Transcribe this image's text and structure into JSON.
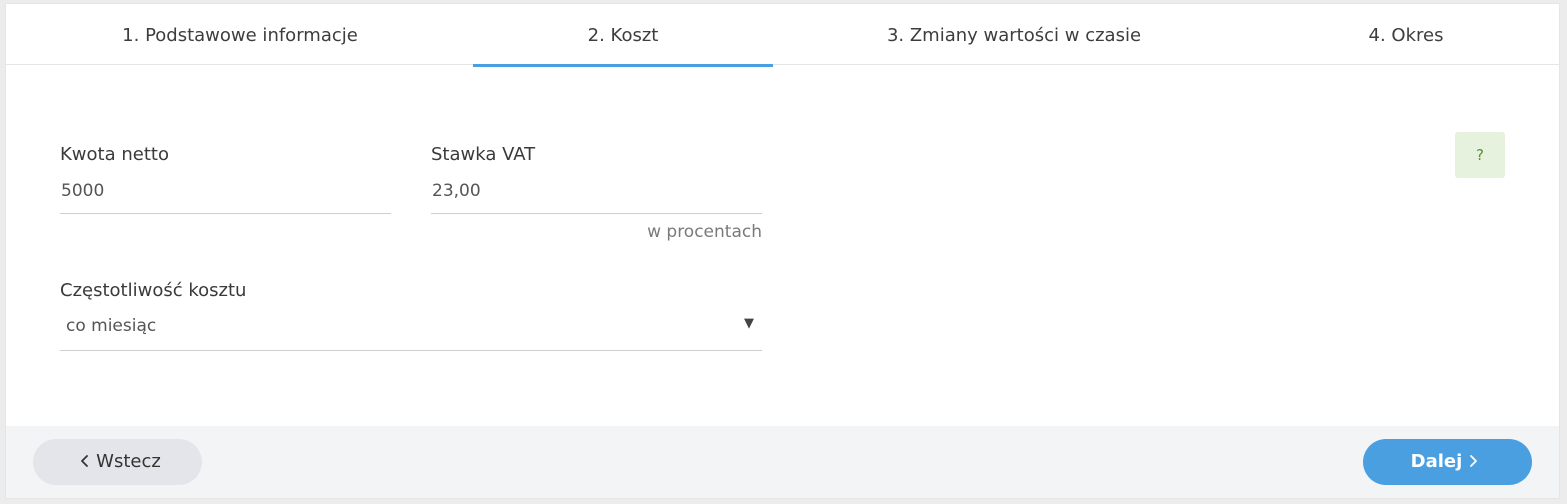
{
  "tabs": [
    {
      "label": "1. Podstawowe informacje"
    },
    {
      "label": "2. Koszt"
    },
    {
      "label": "3. Zmiany wartości w czasie"
    },
    {
      "label": "4. Okres"
    }
  ],
  "active_tab": 1,
  "form": {
    "net_amount": {
      "label": "Kwota netto",
      "value": "5000"
    },
    "vat_rate": {
      "label": "Stawka VAT",
      "value": "23,00",
      "hint": "w procentach"
    },
    "frequency": {
      "label": "Częstotliwość kosztu",
      "value": "co miesiąc"
    }
  },
  "help": {
    "label": "?"
  },
  "footer": {
    "back_label": "Wstecz",
    "next_label": "Dalej",
    "back_icon": "chevron-left-icon",
    "next_icon": "chevron-right-icon"
  },
  "colors": {
    "accent": "#4a9fe0",
    "help_bg": "#e6f2dd",
    "help_fg": "#5b8f3a",
    "footer_bg": "#f3f4f6"
  }
}
